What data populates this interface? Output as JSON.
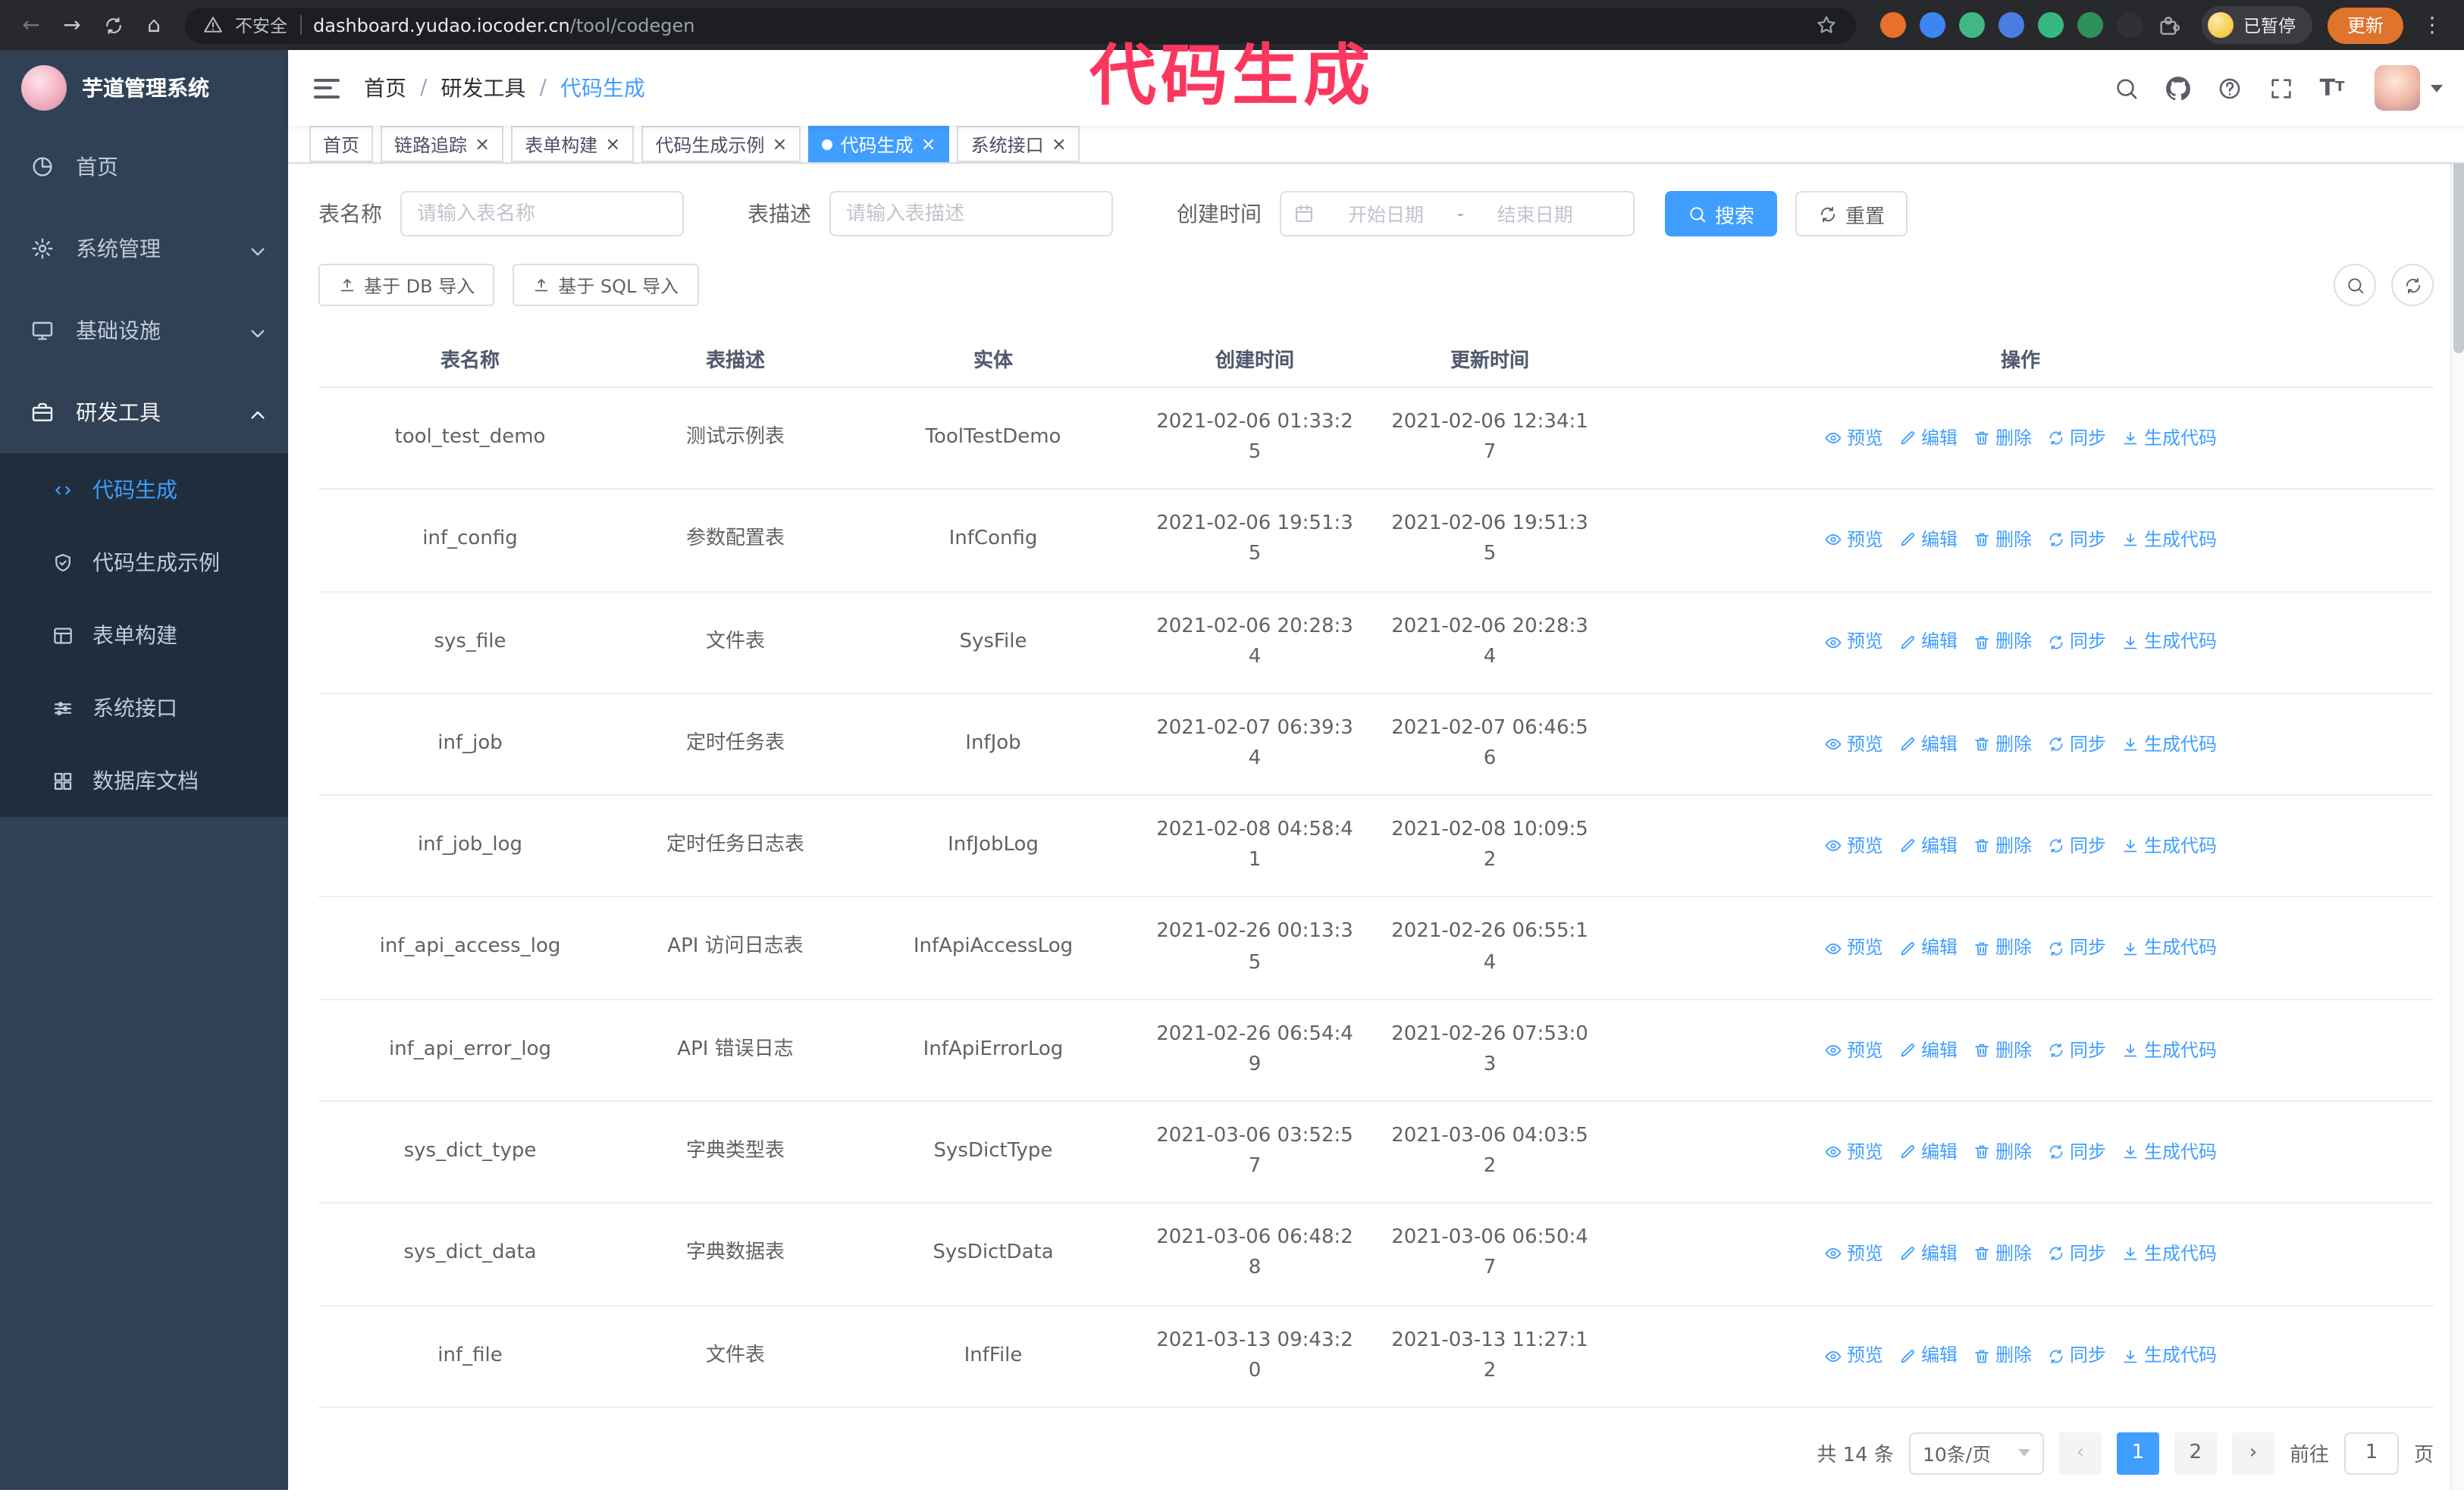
{
  "theme": {
    "accent": "#409eff",
    "sidebar_bg": "#304156",
    "submenu_bg": "#1f2d3d",
    "annotation_color": "#fb3760",
    "update_button_color": "#e0742c"
  },
  "annotation": {
    "text": "代码生成"
  },
  "browser": {
    "security_label": "不安全",
    "url_domain": "dashboard.yudao.iocoder.cn",
    "url_path": "/tool/codegen",
    "paused_label": "已暂停",
    "update_label": "更新",
    "extension_icons": [
      {
        "name": "fox-extension-icon",
        "color": "#e8702a"
      },
      {
        "name": "drop-extension-icon",
        "color": "#3d85f0"
      },
      {
        "name": "vue-devtools-extension-icon",
        "color": "#41b883"
      },
      {
        "name": "users-extension-icon",
        "color": "#4a7de0"
      },
      {
        "name": "capture-extension-icon",
        "color": "#35b87f"
      },
      {
        "name": "leaf-extension-icon",
        "color": "#2e8f5a"
      },
      {
        "name": "tampermonkey-extension-icon",
        "color": "#2f3136"
      },
      {
        "name": "extensions-puzzle-icon",
        "color": ""
      }
    ]
  },
  "sidebar": {
    "logo_title": "芋道管理系统",
    "items": [
      {
        "label": "首页",
        "icon": "dashboard-icon"
      },
      {
        "label": "系统管理",
        "icon": "gear-icon",
        "chevron": "down"
      },
      {
        "label": "基础设施",
        "icon": "monitor-icon",
        "chevron": "down"
      },
      {
        "label": "研发工具",
        "icon": "toolbox-icon",
        "chevron": "up",
        "expanded": true
      }
    ],
    "subitems": [
      {
        "label": "代码生成",
        "icon": "code-icon",
        "active": true
      },
      {
        "label": "代码生成示例",
        "icon": "shield-icon"
      },
      {
        "label": "表单构建",
        "icon": "table-icon"
      },
      {
        "label": "系统接口",
        "icon": "sliders-icon"
      },
      {
        "label": "数据库文档",
        "icon": "grid-icon"
      }
    ]
  },
  "header": {
    "breadcrumb": [
      "首页",
      "研发工具",
      "代码生成"
    ]
  },
  "tabs": [
    {
      "label": "首页",
      "closable": false,
      "active": false
    },
    {
      "label": "链路追踪",
      "closable": true,
      "active": false
    },
    {
      "label": "表单构建",
      "closable": true,
      "active": false
    },
    {
      "label": "代码生成示例",
      "closable": true,
      "active": false
    },
    {
      "label": "代码生成",
      "closable": true,
      "active": true
    },
    {
      "label": "系统接口",
      "closable": true,
      "active": false
    }
  ],
  "filters": {
    "table_name_label": "表名称",
    "table_name_placeholder": "请输入表名称",
    "table_desc_label": "表描述",
    "table_desc_placeholder": "请输入表描述",
    "create_time_label": "创建时间",
    "date_start_placeholder": "开始日期",
    "date_separator": "-",
    "date_end_placeholder": "结束日期",
    "search_label": "搜索",
    "reset_label": "重置"
  },
  "toolbar": {
    "import_db_label": "基于 DB 导入",
    "import_sql_label": "基于 SQL 导入"
  },
  "table": {
    "columns": [
      "表名称",
      "表描述",
      "实体",
      "创建时间",
      "更新时间",
      "操作"
    ],
    "actions": [
      {
        "key": "preview",
        "label": "预览",
        "icon": "eye-icon"
      },
      {
        "key": "edit",
        "label": "编辑",
        "icon": "edit-icon"
      },
      {
        "key": "delete",
        "label": "删除",
        "icon": "delete-icon"
      },
      {
        "key": "sync",
        "label": "同步",
        "icon": "refresh-icon"
      },
      {
        "key": "generate-code",
        "label": "生成代码",
        "icon": "download-icon"
      }
    ],
    "rows": [
      {
        "name": "tool_test_demo",
        "desc": "测试示例表",
        "entity": "ToolTestDemo",
        "create_time": "2021-02-06 01:33:25",
        "update_time": "2021-02-06 12:34:17"
      },
      {
        "name": "inf_config",
        "desc": "参数配置表",
        "entity": "InfConfig",
        "create_time": "2021-02-06 19:51:35",
        "update_time": "2021-02-06 19:51:35"
      },
      {
        "name": "sys_file",
        "desc": "文件表",
        "entity": "SysFile",
        "create_time": "2021-02-06 20:28:34",
        "update_time": "2021-02-06 20:28:34"
      },
      {
        "name": "inf_job",
        "desc": "定时任务表",
        "entity": "InfJob",
        "create_time": "2021-02-07 06:39:34",
        "update_time": "2021-02-07 06:46:56"
      },
      {
        "name": "inf_job_log",
        "desc": "定时任务日志表",
        "entity": "InfJobLog",
        "create_time": "2021-02-08 04:58:41",
        "update_time": "2021-02-08 10:09:52"
      },
      {
        "name": "inf_api_access_log",
        "desc": "API 访问日志表",
        "entity": "InfApiAccessLog",
        "create_time": "2021-02-26 00:13:35",
        "update_time": "2021-02-26 06:55:14"
      },
      {
        "name": "inf_api_error_log",
        "desc": "API 错误日志",
        "entity": "InfApiErrorLog",
        "create_time": "2021-02-26 06:54:49",
        "update_time": "2021-02-26 07:53:03"
      },
      {
        "name": "sys_dict_type",
        "desc": "字典类型表",
        "entity": "SysDictType",
        "create_time": "2021-03-06 03:52:57",
        "update_time": "2021-03-06 04:03:52"
      },
      {
        "name": "sys_dict_data",
        "desc": "字典数据表",
        "entity": "SysDictData",
        "create_time": "2021-03-06 06:48:28",
        "update_time": "2021-03-06 06:50:47"
      },
      {
        "name": "inf_file",
        "desc": "文件表",
        "entity": "InfFile",
        "create_time": "2021-03-13 09:43:20",
        "update_time": "2021-03-13 11:27:12"
      }
    ]
  },
  "pagination": {
    "total_label": "共 14 条",
    "page_size_label": "10条/页",
    "pages": [
      "1",
      "2"
    ],
    "active_page": "1",
    "goto_label": "前往",
    "goto_value": "1",
    "page_suffix_label": "页"
  }
}
